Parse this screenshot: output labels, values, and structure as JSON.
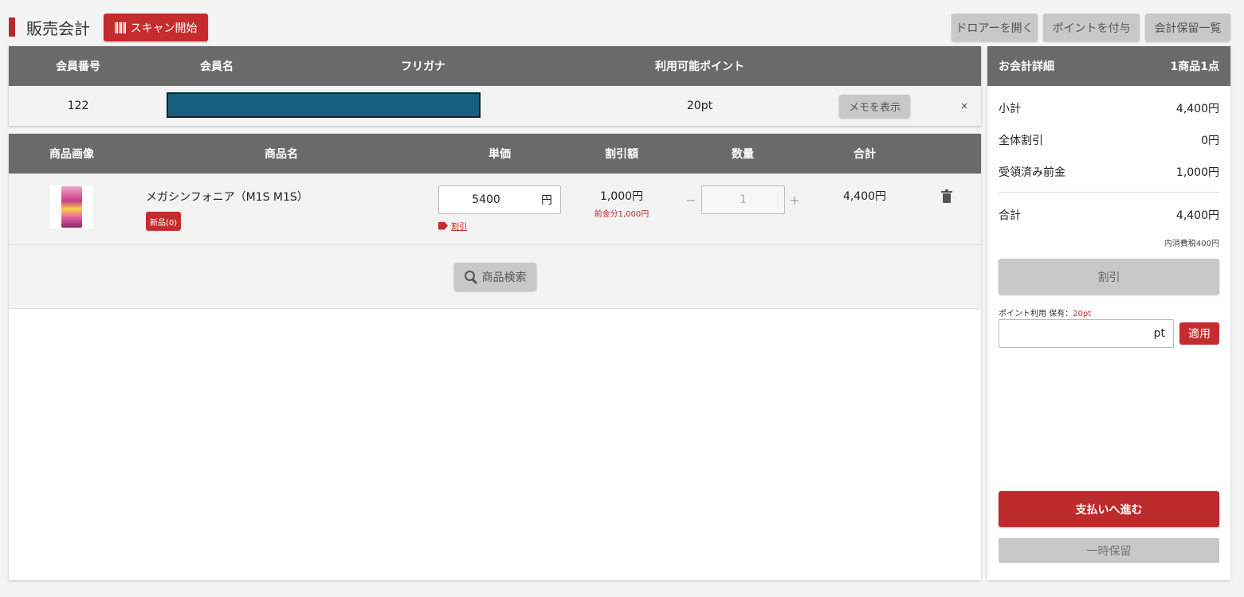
{
  "header": {
    "title": "販売会計",
    "scan_button": "スキャン開始",
    "buttons": [
      "ドロアーを開く",
      "ポイントを付与",
      "会計保留一覧"
    ]
  },
  "member": {
    "columns": [
      "会員番号",
      "会員名",
      "フリガナ",
      "利用可能ポイント"
    ],
    "number": "122",
    "points": "20pt",
    "memo_button": "メモを表示",
    "close": "×"
  },
  "products": {
    "columns": [
      "商品画像",
      "商品名",
      "単価",
      "割引額",
      "数量",
      "合計"
    ],
    "items": [
      {
        "name": "メガシンフォニア（M1S M1S）",
        "badge": "新品(0)",
        "unit_price": "5400",
        "currency": "円",
        "discount_link": "割引",
        "discount_amount": "1,000円",
        "discount_note": "前金分1,000円",
        "quantity": "1",
        "minus": "−",
        "plus": "+",
        "total": "4,400円"
      }
    ],
    "search_button": "商品検索"
  },
  "summary": {
    "title": "お会計詳細",
    "count": "1商品1点",
    "rows": [
      {
        "label": "小計",
        "value": "4,400円"
      },
      {
        "label": "全体割引",
        "value": "0円"
      },
      {
        "label": "受領済み前金",
        "value": "1,000円"
      }
    ],
    "total_label": "合計",
    "total_value": "4,400円",
    "tax_note": "内消費税400円",
    "discount_button": "割引",
    "point_use_label": "ポイント利用 保有：",
    "point_owned": "20pt",
    "point_unit": "pt",
    "apply_button": "適用",
    "pay_button": "支払いへ進む",
    "hold_button": "一時保留"
  },
  "colors": {
    "accent": "#c52c2e",
    "header_bg": "#6a6a6a",
    "button_gray": "#c8c8c8",
    "redaction": "#155f83"
  }
}
